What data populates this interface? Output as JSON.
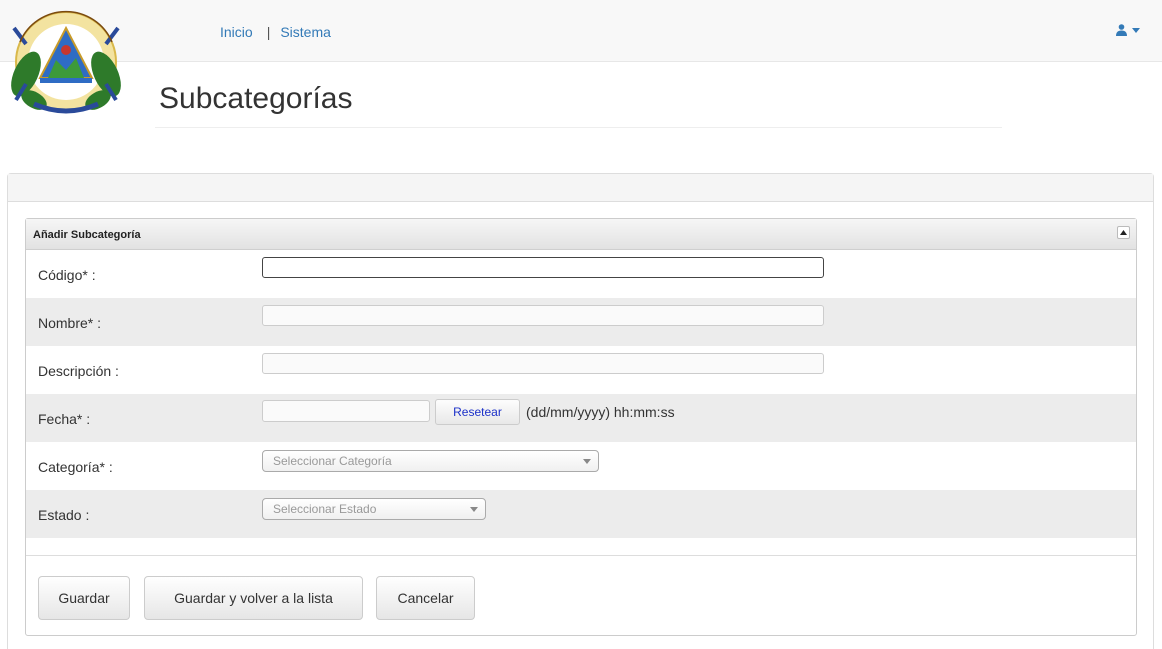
{
  "nav": {
    "links": [
      "Inicio",
      "Sistema"
    ],
    "separator": "|"
  },
  "page": {
    "title": "Subcategorías"
  },
  "form": {
    "section_title": "Añadir Subcategoría",
    "fields": {
      "codigo": {
        "label": "Código* :",
        "value": ""
      },
      "nombre": {
        "label": "Nombre* :",
        "value": ""
      },
      "descripcion": {
        "label": "Descripción :",
        "value": ""
      },
      "fecha": {
        "label": "Fecha* :",
        "value": "",
        "reset_label": "Resetear",
        "hint": "(dd/mm/yyyy) hh:mm:ss"
      },
      "categoria": {
        "label": "Categoría* :",
        "placeholder": "Seleccionar Categoría"
      },
      "estado": {
        "label": "Estado :",
        "placeholder": "Seleccionar Estado"
      }
    },
    "buttons": {
      "save": "Guardar",
      "save_return": "Guardar y volver a la lista",
      "cancel": "Cancelar"
    }
  },
  "colors": {
    "link": "#337ab7",
    "user_icon": "#337ab7",
    "reset_text": "#1a2fc8"
  },
  "icons": {
    "user": "user-icon",
    "user_caret": "caret-down-icon",
    "collapse": "triangle-up-icon",
    "logo": "coat-of-arms-logo"
  }
}
